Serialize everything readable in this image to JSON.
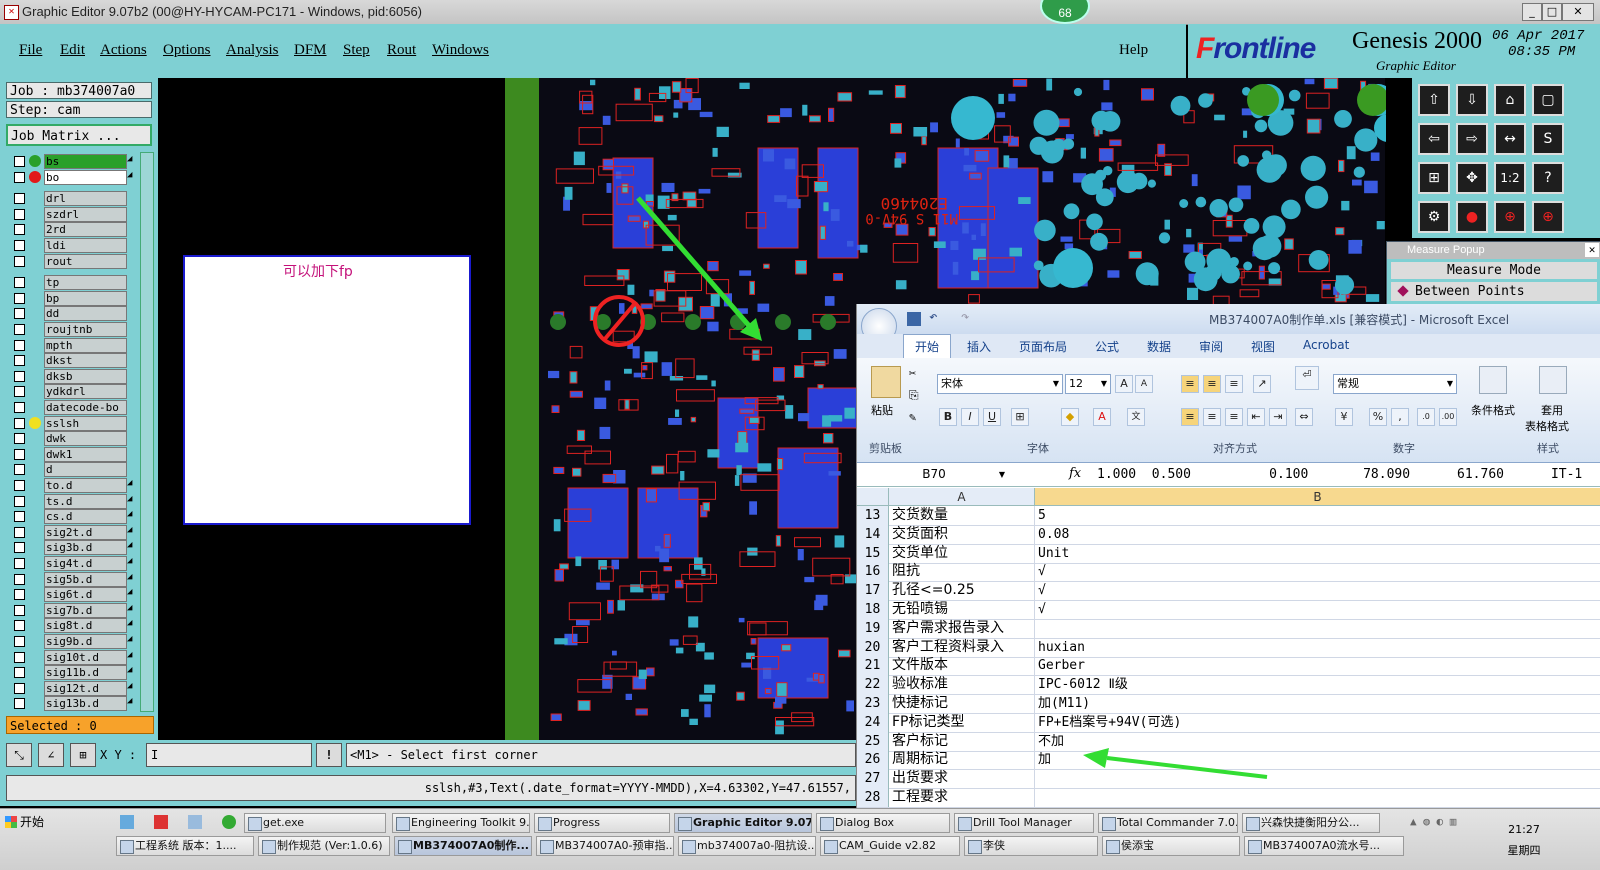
{
  "window": {
    "title": "Graphic Editor 9.07b2 (00@HY-HYCAM-PC171 - Windows, pid:6056)",
    "badge": "68"
  },
  "menu": {
    "items": [
      "File",
      "Edit",
      "Actions",
      "Options",
      "Analysis",
      "DFM",
      "Step",
      "Rout",
      "Windows"
    ],
    "help": "Help"
  },
  "brand": {
    "logo_a": "F",
    "logo_b": "rontline",
    "product": "Genesis 2000",
    "subtitle": "Graphic Editor",
    "date": "06 Apr 2017",
    "time": "08:35 PM"
  },
  "job": {
    "job": "Job : mb374007a0",
    "step": "Step: cam",
    "matrix_button": "Job Matrix ..."
  },
  "layers": [
    {
      "name": "bs",
      "color": "#2aa02a",
      "active": true
    },
    {
      "name": "bo",
      "color": "#e21818",
      "active": true
    },
    {
      "name": "drl"
    },
    {
      "name": "szdrl"
    },
    {
      "name": "2rd"
    },
    {
      "name": "ldi"
    },
    {
      "name": "rout"
    },
    {
      "name": "tp"
    },
    {
      "name": "bp"
    },
    {
      "name": "dd"
    },
    {
      "name": "roujtnb"
    },
    {
      "name": "mpth"
    },
    {
      "name": "dkst"
    },
    {
      "name": "dksb"
    },
    {
      "name": "ydkdrl"
    },
    {
      "name": "datecode-bo"
    },
    {
      "name": "sslsh",
      "color": "#f0e020"
    },
    {
      "name": "dwk"
    },
    {
      "name": "dwk1"
    },
    {
      "name": "d"
    },
    {
      "name": "to.d"
    },
    {
      "name": "ts.d"
    },
    {
      "name": "cs.d"
    },
    {
      "name": "sig2t.d"
    },
    {
      "name": "sig3b.d"
    },
    {
      "name": "sig4t.d"
    },
    {
      "name": "sig5b.d"
    },
    {
      "name": "sig6t.d"
    },
    {
      "name": "sig7b.d"
    },
    {
      "name": "sig8t.d"
    },
    {
      "name": "sig9b.d"
    },
    {
      "name": "sig10t.d"
    },
    {
      "name": "sig11b.d"
    },
    {
      "name": "sig12t.d"
    },
    {
      "name": "sig13b.d"
    }
  ],
  "selected": "Selected : 0",
  "note": {
    "text": "可以加下fp"
  },
  "board": {
    "markings": [
      "E204460",
      "M11 S 94V-0"
    ]
  },
  "measure": {
    "title": "Measure Popup",
    "mode": "Measure Mode",
    "option": "Between Points"
  },
  "excel": {
    "title": "MB374007A0制作单.xls  [兼容模式] - Microsoft Excel",
    "tabs": [
      "开始",
      "插入",
      "页面布局",
      "公式",
      "数据",
      "审阅",
      "视图",
      "Acrobat"
    ],
    "font": "宋体",
    "size": "12",
    "number_format": "常规",
    "groups": [
      "剪贴板",
      "字体",
      "对齐方式",
      "数字",
      "样式"
    ],
    "paste": "粘贴",
    "cond_format": "条件格式",
    "table_format_1": "套用",
    "table_format_2": "表格格式",
    "name_box": "B70",
    "formula": "1.000  0.500          0.100       78.090      61.760      IT-1",
    "columns": [
      "A",
      "B"
    ],
    "rows": [
      {
        "n": "13",
        "a": "交货数量",
        "b": "5"
      },
      {
        "n": "14",
        "a": "交货面积",
        "b": "0.08"
      },
      {
        "n": "15",
        "a": "交货单位",
        "b": "Unit"
      },
      {
        "n": "16",
        "a": "阻抗",
        "b": "√"
      },
      {
        "n": "17",
        "a": "孔径<=0.25",
        "b": "√"
      },
      {
        "n": "18",
        "a": "无铅喷锡",
        "b": "√"
      },
      {
        "n": "19",
        "a": "客户需求报告录入",
        "b": ""
      },
      {
        "n": "20",
        "a": "客户工程资料录入",
        "b": "huxian"
      },
      {
        "n": "21",
        "a": "文件版本",
        "b": "Gerber"
      },
      {
        "n": "22",
        "a": "验收标准",
        "b": "IPC-6012 Ⅱ级"
      },
      {
        "n": "23",
        "a": "快捷标记",
        "b": "加(M11)"
      },
      {
        "n": "24",
        "a": "FP标记类型",
        "b": "FP+E档案号+94V(可选)"
      },
      {
        "n": "25",
        "a": "客户标记",
        "b": "不加"
      },
      {
        "n": "26",
        "a": "周期标记",
        "b": "加"
      },
      {
        "n": "27",
        "a": "出货要求",
        "b": ""
      },
      {
        "n": "28",
        "a": "工程要求",
        "b": ""
      }
    ]
  },
  "command": {
    "xy_label": "X Y :",
    "xy_value": "I",
    "prompt": "<M1> - Select first corner",
    "status": "sslsh,#3,Text(.date_format=YYYY-MMDD),X=4.63302,Y=47.61557,"
  },
  "taskbar": {
    "start": "开始",
    "row1": [
      "get.exe",
      "Engineering Toolkit 9....",
      "Progress",
      "Graphic Editor 9.07b2...",
      "Dialog Box",
      "Drill Tool Manager",
      "Total Commander 7.0...",
      "兴森快捷衡阳分公..."
    ],
    "row2": [
      "工程系统  版本：1....",
      "制作规范 (Ver:1.0.6)",
      "MB374007A0制作...",
      "MB374007A0-预审指...",
      "mb374007a0-阻抗设...",
      "CAM_Guide v2.82",
      "李侠",
      "侯添宝",
      "MB374007A0流水号..."
    ],
    "clock_time": "21:27",
    "clock_day": "星期四"
  },
  "colors": {
    "panel": "#7fd0d3",
    "accent_green": "#33dd33"
  }
}
